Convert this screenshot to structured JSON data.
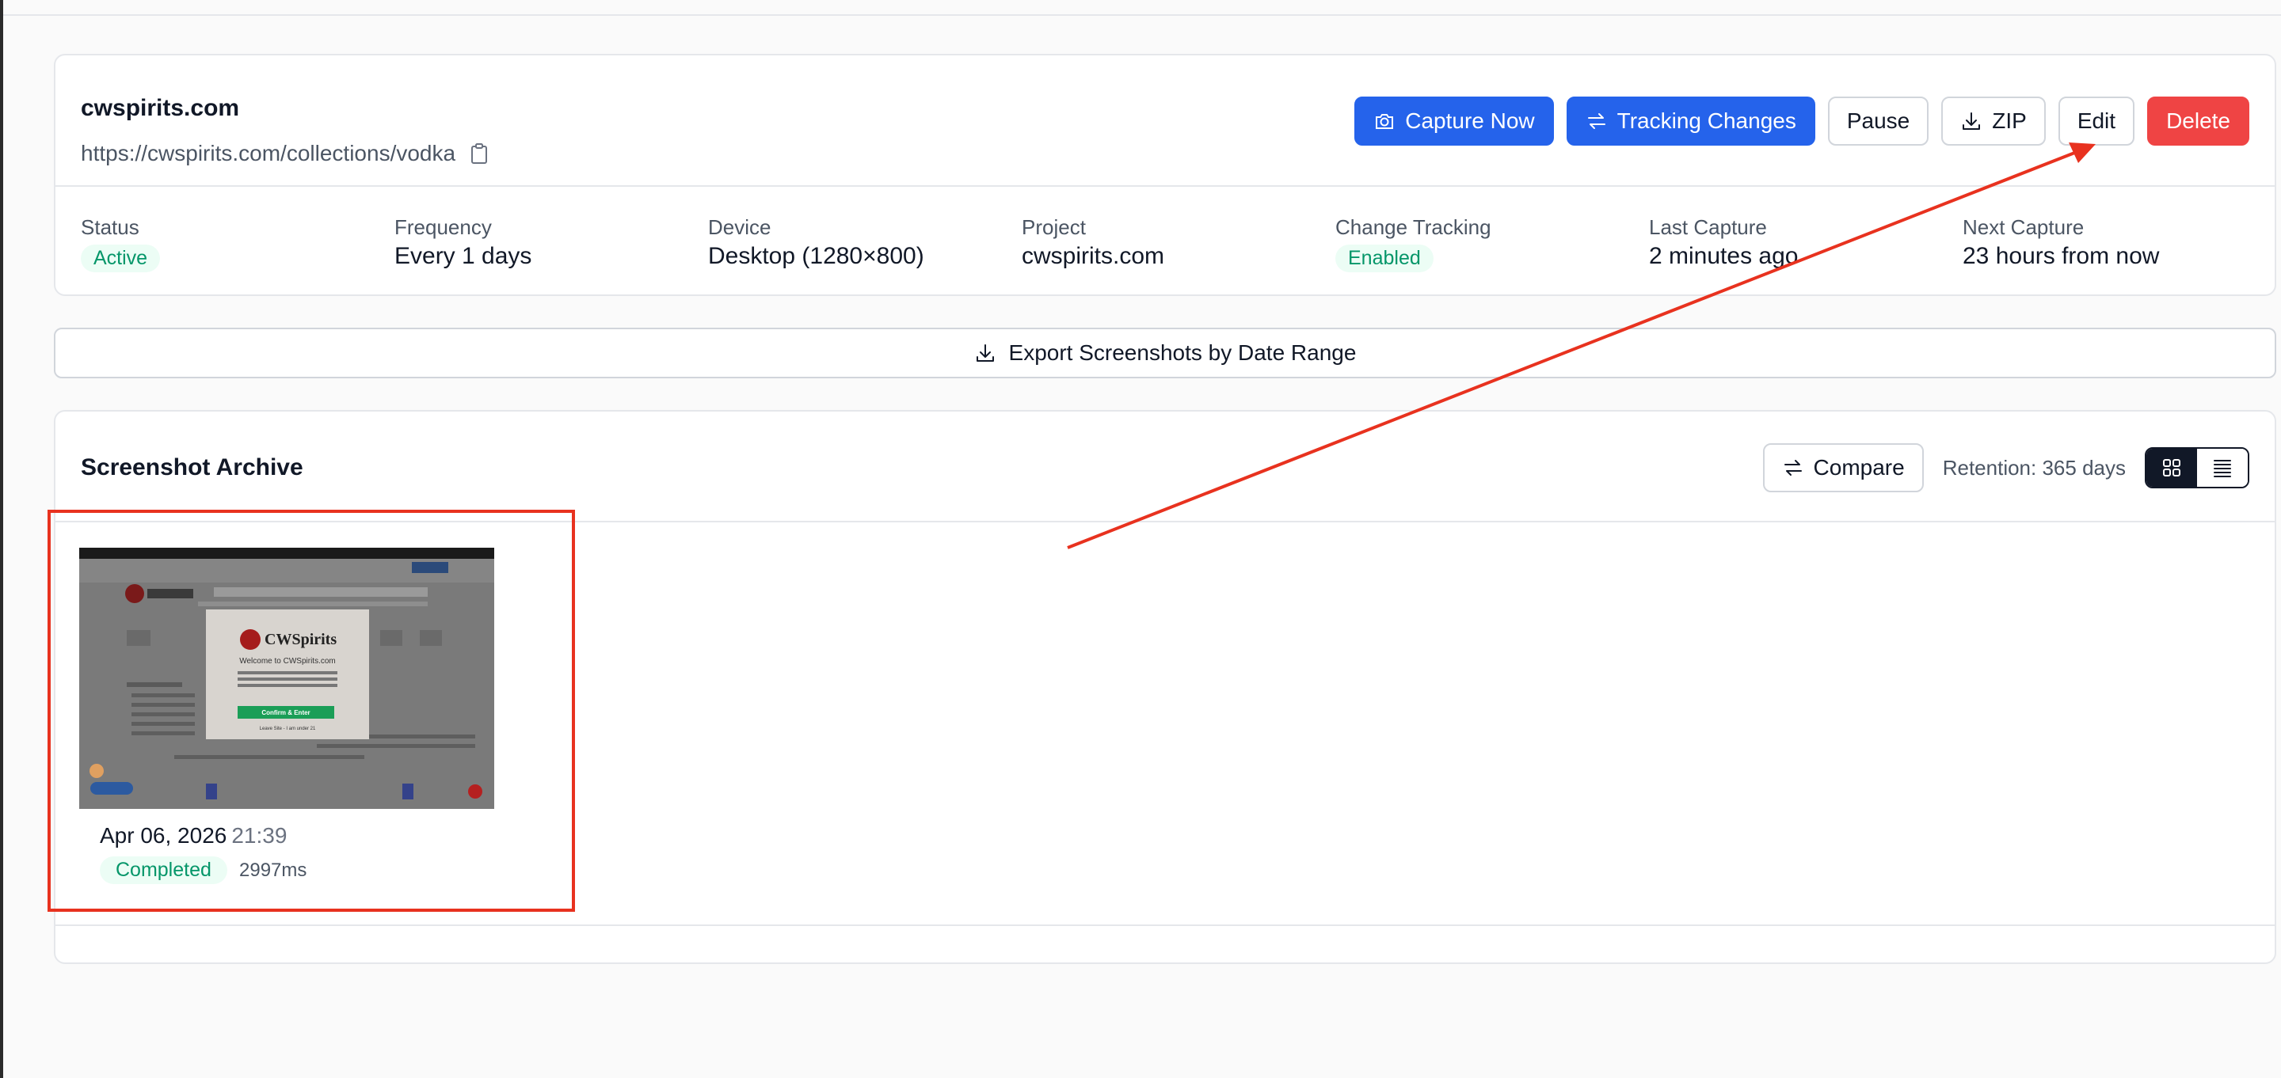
{
  "monitor": {
    "title": "cwspirits.com",
    "url": "https://cwspirits.com/collections/vodka",
    "actions": {
      "capture_now": "Capture Now",
      "tracking_changes": "Tracking Changes",
      "pause": "Pause",
      "zip": "ZIP",
      "edit": "Edit",
      "delete": "Delete"
    },
    "stats": {
      "status": {
        "label": "Status",
        "value": "Active"
      },
      "frequency": {
        "label": "Frequency",
        "value": "Every 1 days"
      },
      "device": {
        "label": "Device",
        "value": "Desktop (1280×800)"
      },
      "project": {
        "label": "Project",
        "value": "cwspirits.com"
      },
      "change_tracking": {
        "label": "Change Tracking",
        "value": "Enabled"
      },
      "last_capture": {
        "label": "Last Capture",
        "value": "2 minutes ago"
      },
      "next_capture": {
        "label": "Next Capture",
        "value": "23 hours from now"
      }
    }
  },
  "export": {
    "label": "Export Screenshots by Date Range"
  },
  "archive": {
    "title": "Screenshot Archive",
    "compare_label": "Compare",
    "retention": "Retention: 365 days",
    "items": [
      {
        "date": "Apr 06, 2026",
        "time": "21:39",
        "status": "Completed",
        "duration": "2997ms",
        "thumb": {
          "brand": "CWSpirits",
          "welcome": "Welcome to CWSpirits.com",
          "confirm": "Confirm & Enter",
          "leave": "Leave Site - I am under 21"
        }
      }
    ]
  },
  "colors": {
    "primary": "#2563eb",
    "danger": "#ef4444",
    "success_text": "#059669",
    "success_bg": "#ecfdf5",
    "annotation": "#e8321f"
  },
  "icons": {
    "clipboard": "clipboard-icon",
    "camera": "camera-icon",
    "swap": "arrows-swap-icon",
    "download": "download-icon",
    "grid": "grid-view-icon",
    "list": "list-view-icon"
  }
}
